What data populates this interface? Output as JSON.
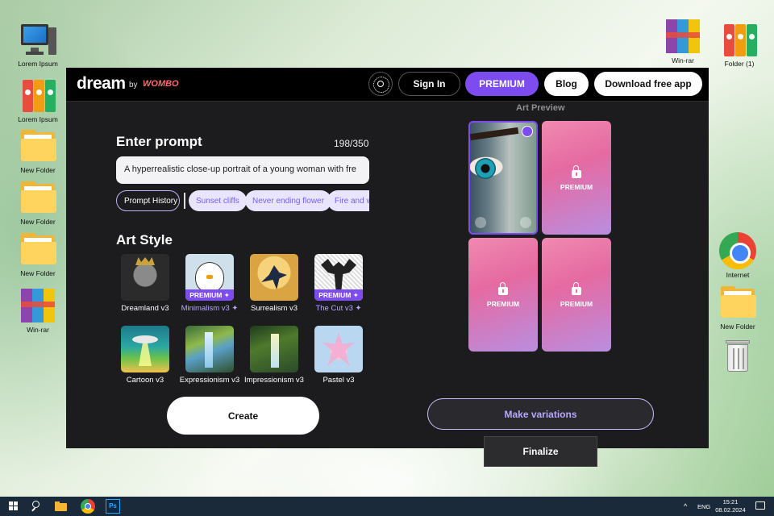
{
  "desktop": {
    "icons_left": [
      {
        "label": "Lorem Ipsum"
      },
      {
        "label": "Lorem Ipsum"
      },
      {
        "label": "New Folder"
      },
      {
        "label": "New Folder"
      },
      {
        "label": "New Folder"
      },
      {
        "label": "Win-rar"
      }
    ],
    "icons_right": [
      {
        "label": "Win-rar"
      },
      {
        "label": "Folder (1)"
      },
      {
        "label": "Internet"
      },
      {
        "label": "New Folder"
      }
    ]
  },
  "app": {
    "logo": {
      "name": "dream",
      "by": "by",
      "brand": "WOMBO"
    },
    "header": {
      "signin": "Sign In",
      "premium": "PREMIUM",
      "blog": "Blog",
      "download": "Download free app"
    },
    "prompt": {
      "title": "Enter prompt",
      "counter": "198/350",
      "value": "A hyperrealistic close-up portrait of a young woman with fre"
    },
    "chips": {
      "history": "Prompt History",
      "suggestions": [
        "Sunset cliffs",
        "Never ending flower",
        "Fire and wa"
      ]
    },
    "art_style": {
      "title": "Art Style",
      "premium_badge": "PREMIUM ✦",
      "styles": [
        {
          "name": "Dreamland v3",
          "premium": false
        },
        {
          "name": "Minimalism v3 ✦",
          "premium": true
        },
        {
          "name": "Surrealism v3",
          "premium": false
        },
        {
          "name": "The Cut v3 ✦",
          "premium": true
        },
        {
          "name": "Cartoon v3",
          "premium": false
        },
        {
          "name": "Expressionism v3",
          "premium": false
        },
        {
          "name": "Impressionism v3",
          "premium": false
        },
        {
          "name": "Pastel v3",
          "premium": false
        }
      ]
    },
    "create": "Create",
    "preview": {
      "title": "Art Preview",
      "locked_label": "PREMIUM",
      "make_variations": "Make variations",
      "finalize": "Finalize"
    }
  },
  "taskbar": {
    "lang": "ENG",
    "time": "15:21",
    "date": "08.02.2024"
  },
  "colors": {
    "accent": "#7d4cf0",
    "app_bg": "#1c1c1e",
    "locked_gradient_start": "#f08ab1",
    "locked_gradient_end": "#b98ee0"
  }
}
